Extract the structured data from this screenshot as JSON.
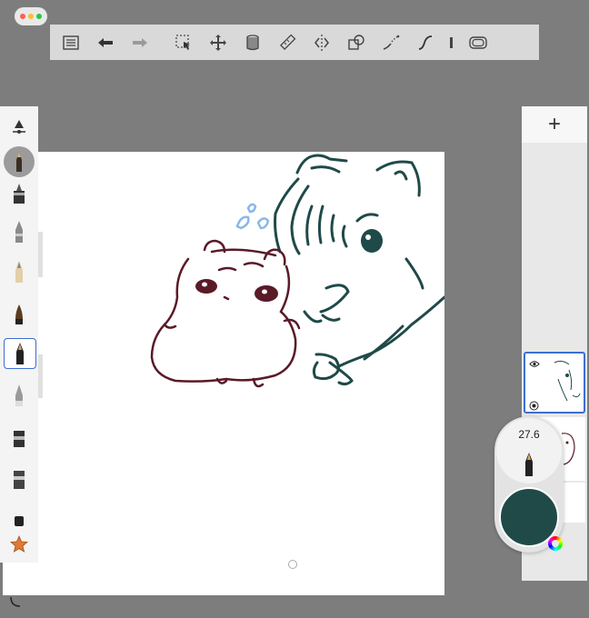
{
  "window": {
    "traffic_lights": [
      "#ff5f57",
      "#febc2e",
      "#28c840"
    ]
  },
  "toolbar": {
    "items": [
      {
        "name": "layers-list-icon",
        "label": ""
      },
      {
        "name": "undo-icon",
        "label": ""
      },
      {
        "name": "redo-icon",
        "label": ""
      },
      {
        "name": "selection-icon",
        "label": ""
      },
      {
        "name": "transform-icon",
        "label": ""
      },
      {
        "name": "fill-bucket-icon",
        "label": ""
      },
      {
        "name": "ruler-icon",
        "label": ""
      },
      {
        "name": "symmetry-icon",
        "label": ""
      },
      {
        "name": "shapes-icon",
        "label": ""
      },
      {
        "name": "predictive-stroke-icon",
        "label": ""
      },
      {
        "name": "steady-stroke-icon",
        "label": ""
      },
      {
        "name": "perspective-icon",
        "label": ""
      },
      {
        "name": "fullscreen-icon",
        "label": ""
      }
    ]
  },
  "brush_panel": {
    "brushes": [
      "pencil-brush",
      "technical-pen-brush",
      "marker-brush",
      "fountain-pen-brush",
      "ink-brush",
      "selected-pen-brush",
      "airbrush-brush",
      "chisel-marker-brush",
      "wide-marker-brush",
      "eraser-brush",
      "favorites-star"
    ]
  },
  "brush_size": "27.6",
  "current_color": "#1f4a48",
  "colors": {
    "hamster_stroke": "#5a1a28",
    "cat_stroke": "#1f4a48",
    "sweat_stroke": "#8ab8e8",
    "accent": "#3d6fd1"
  },
  "layers_panel": {
    "add_label": "+"
  }
}
